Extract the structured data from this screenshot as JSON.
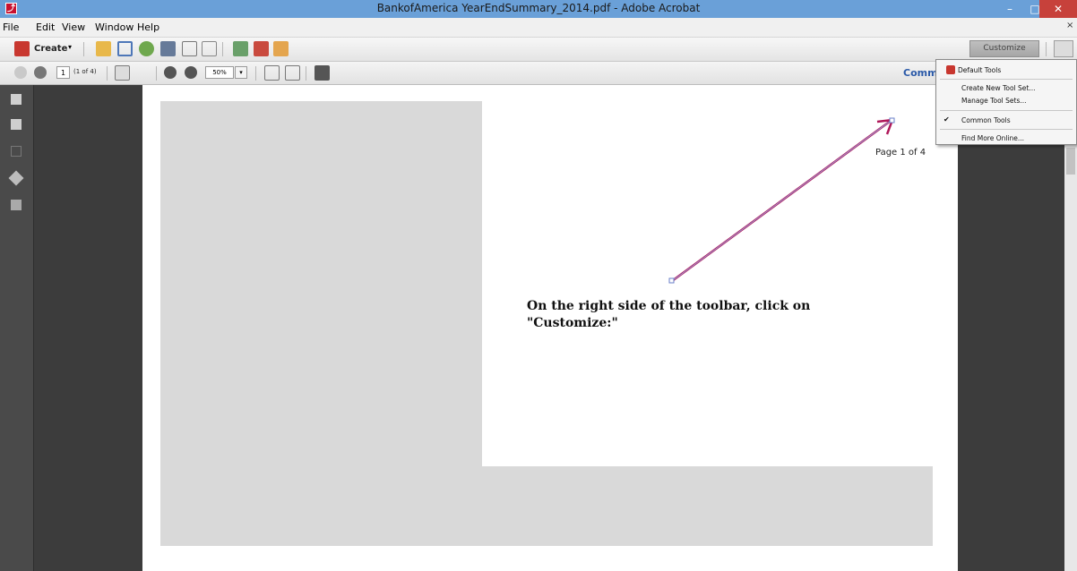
{
  "window": {
    "title": "BankofAmerica YearEndSummary_2014.pdf - Adobe Acrobat",
    "min_symbol": "–",
    "max_symbol": "□",
    "close_symbol": "✕",
    "doc_close_symbol": "×"
  },
  "menubar": {
    "items": [
      "File",
      "Edit",
      "View",
      "Window",
      "Help"
    ]
  },
  "toolbar": {
    "create_label": "Create",
    "customize_label": "Customize"
  },
  "navbar": {
    "page_number": "1",
    "page_of": "(1 of 4)",
    "zoom": "50%",
    "comment_label": "Comme"
  },
  "document": {
    "instruction_line1": "On the right side of the toolbar, click on",
    "instruction_line2": "\"Customize:\"",
    "page_label": "Page 1 of 4"
  },
  "customize_menu": {
    "items": [
      {
        "label": "Default Tools",
        "checked": false
      },
      {
        "label": "Create New Tool Set...",
        "checked": false
      },
      {
        "label": "Manage Tool Sets...",
        "checked": false
      },
      {
        "label": "Common Tools",
        "checked": true
      },
      {
        "label": "Find More Online...",
        "checked": false
      }
    ],
    "check_symbol": "✔"
  },
  "colors": {
    "titlebar": "#6aa0d8",
    "arrow": "#b0185a",
    "comment_link": "#2b5aa8"
  }
}
